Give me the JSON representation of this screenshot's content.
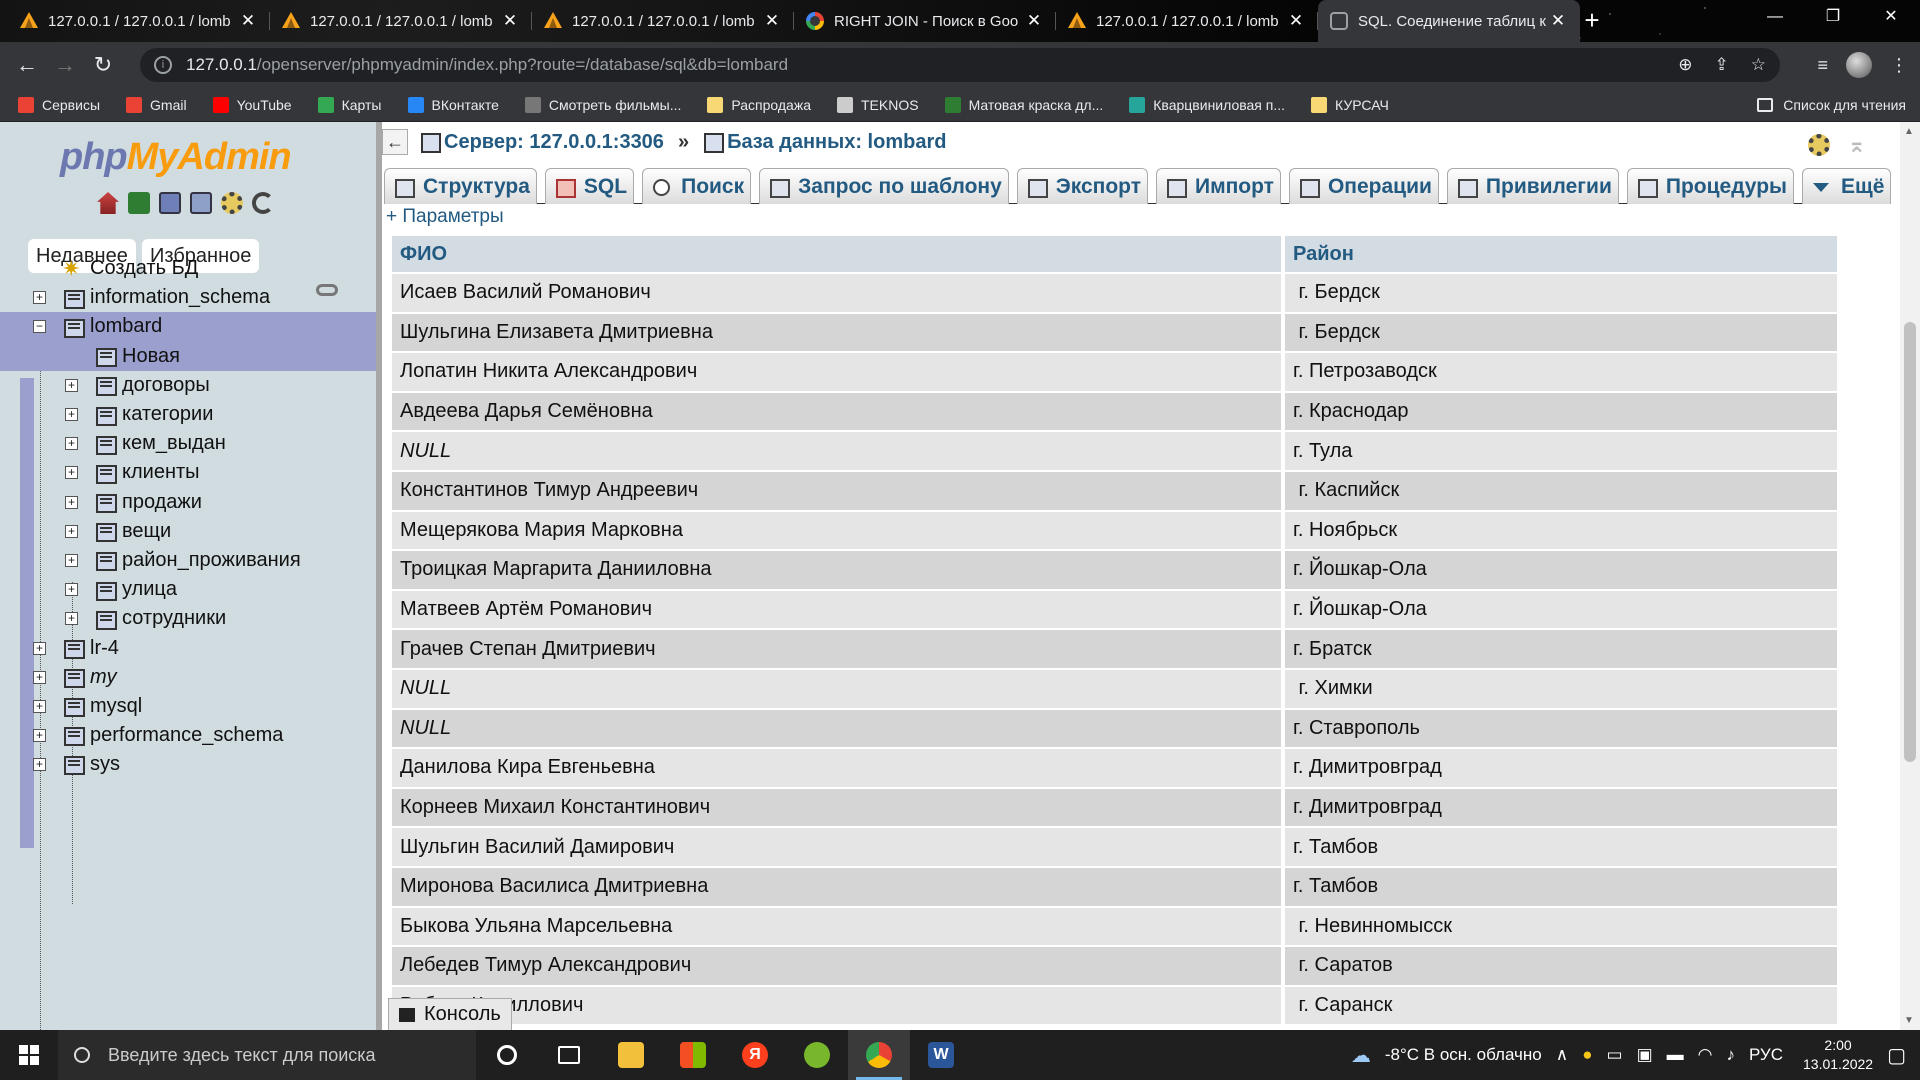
{
  "browser": {
    "tabs": [
      {
        "title": "127.0.0.1 / 127.0.0.1 / lomb",
        "icon": "phpmyadmin-icon",
        "active": false
      },
      {
        "title": "127.0.0.1 / 127.0.0.1 / lomb",
        "icon": "phpmyadmin-icon",
        "active": false
      },
      {
        "title": "127.0.0.1 / 127.0.0.1 / lomb",
        "icon": "phpmyadmin-icon",
        "active": false
      },
      {
        "title": "RIGHT JOIN - Поиск в Goo",
        "icon": "google-icon",
        "active": false
      },
      {
        "title": "127.0.0.1 / 127.0.0.1 / lomb",
        "icon": "phpmyadmin-icon",
        "active": false
      },
      {
        "title": "SQL. Соединение таблиц к",
        "icon": "sql-site-icon",
        "active": true
      }
    ],
    "url_host": "127.0.0.1",
    "url_path": "/openserver/phpmyadmin/index.php?route=/database/sql&db=lombard",
    "bookmarks": [
      {
        "label": "Сервисы",
        "icon": "apps-grid-icon",
        "color": "#ea4335"
      },
      {
        "label": "Gmail",
        "icon": "gmail-icon",
        "color": "#ea4335"
      },
      {
        "label": "YouTube",
        "icon": "youtube-icon",
        "color": "#ff0000"
      },
      {
        "label": "Карты",
        "icon": "maps-icon",
        "color": "#34a853"
      },
      {
        "label": "ВКонтакте",
        "icon": "vk-icon",
        "color": "#2787f5"
      },
      {
        "label": "Смотреть фильмы...",
        "icon": "hd-icon",
        "color": "#777777"
      },
      {
        "label": "Распродажа",
        "icon": "folder-icon",
        "color": "#f8d775"
      },
      {
        "label": "TEKNOS",
        "icon": "teknos-icon",
        "color": "#cccccc"
      },
      {
        "label": "Матовая краска дл...",
        "icon": "triangle-icon",
        "color": "#2e7d32"
      },
      {
        "label": "Кварцвиниловая п...",
        "icon": "diamond-icon",
        "color": "#26a69a"
      },
      {
        "label": "КУРСАЧ",
        "icon": "folder-icon",
        "color": "#f8d775"
      }
    ],
    "reading_list": "Список для чтения"
  },
  "pma_nav": {
    "logo_php": "php",
    "logo_myadmin": "MyAdmin",
    "tab_recent": "Недавнее",
    "tab_favorites": "Избранное",
    "create_db": "Создать БД",
    "databases": [
      {
        "name": "information_schema",
        "italic": false
      },
      {
        "name": "lombard",
        "italic": false,
        "expanded": true
      }
    ],
    "lombard_new": "Новая",
    "lombard_tables": [
      "договоры",
      "категории",
      "кем_выдан",
      "клиенты",
      "продажи",
      "вещи",
      "район_проживания",
      "улица",
      "сотрудники"
    ],
    "databases_after": [
      {
        "name": "lr-4",
        "italic": false
      },
      {
        "name": "my",
        "italic": true
      },
      {
        "name": "mysql",
        "italic": false
      },
      {
        "name": "performance_schema",
        "italic": false
      },
      {
        "name": "sys",
        "italic": false
      }
    ]
  },
  "breadcrumb": {
    "server": "Сервер: 127.0.0.1:3306",
    "separator": "»",
    "database": "База данных: lombard"
  },
  "menu": [
    "Структура",
    "SQL",
    "Поиск",
    "Запрос по шаблону",
    "Экспорт",
    "Импорт",
    "Операции",
    "Привилегии",
    "Процедуры",
    "Ещё"
  ],
  "params_link": "+ Параметры",
  "results": {
    "columns": [
      "ФИО",
      "Район"
    ],
    "rows": [
      [
        "Исаев Василий Романович",
        " г. Бердск"
      ],
      [
        "Шульгина Елизавета Дмитриевна",
        " г. Бердск"
      ],
      [
        "Лопатин Никита Александрович",
        "г. Петрозаводск"
      ],
      [
        "Авдеева Дарья Семёновна",
        "г. Краснодар"
      ],
      [
        "NULL",
        "г. Тула"
      ],
      [
        "Константинов Тимур Андреевич",
        " г. Каспийск"
      ],
      [
        "Мещерякова Мария Марковна",
        "г. Ноябрьск"
      ],
      [
        "Троицкая Маргарита Данииловна",
        "г. Йошкар-Ола"
      ],
      [
        "Матвеев Артём Романович",
        "г. Йошкар-Ола"
      ],
      [
        "Грачев Степан Дмитриевич",
        "г. Братск"
      ],
      [
        "NULL",
        " г. Химки"
      ],
      [
        "NULL",
        "г. Ставрополь"
      ],
      [
        "Данилова Кира Евгеньевна",
        "г. Димитровград"
      ],
      [
        "Корнеев Михаил Константинович",
        "г. Димитровград"
      ],
      [
        "Шульгин Василий Дамирович",
        "г. Тамбов"
      ],
      [
        "Миронова Василиса Дмитриевна",
        "г. Тамбов"
      ],
      [
        "Быкова Ульяна Марсельевна",
        " г. Невинномысск"
      ],
      [
        "Лебедев Тимур Александрович",
        " г. Саратов"
      ],
      [
        "Роберт Кириллович",
        " г. Саранск"
      ]
    ]
  },
  "console_label": "Консоль",
  "taskbar": {
    "search_placeholder": "Введите здесь текст для поиска",
    "weather": "-8°C  В осн. облачно",
    "lang": "РУС",
    "time": "2:00",
    "date": "13.01.2022"
  }
}
